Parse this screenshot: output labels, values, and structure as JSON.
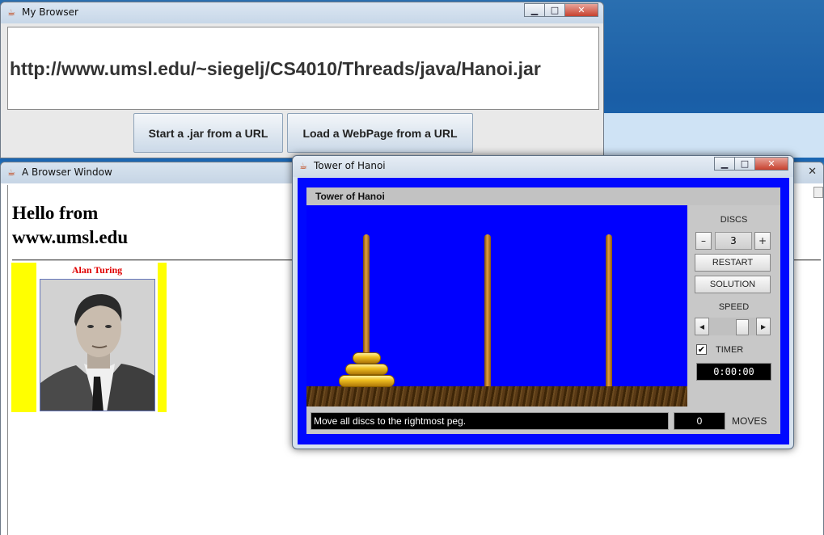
{
  "my_browser": {
    "title": "My Browser",
    "url": "http://www.umsl.edu/~siegelj/CS4010/Threads/java/Hanoi.jar",
    "start_jar_label": "Start a .jar from a URL",
    "load_page_label": "Load a WebPage from a URL"
  },
  "browser_window": {
    "title": "A Browser Window",
    "heading_line1": "Hello from",
    "heading_line2": "www.umsl.edu",
    "image_caption": "Alan Turing"
  },
  "hanoi": {
    "window_title": "Tower of Hanoi",
    "applet_title": "Tower of Hanoi",
    "discs_label": "DISCS",
    "disc_count": "3",
    "minus_label": "–",
    "plus_label": "+",
    "restart_label": "RESTART",
    "solution_label": "SOLUTION",
    "speed_label": "SPEED",
    "timer_checked": true,
    "timer_label": "TIMER",
    "timer_value": "0:00:00",
    "status_message": "Move all discs to the rightmost peg.",
    "moves_value": "0",
    "moves_label": "MOVES"
  },
  "window_controls": {
    "minimize": "▁",
    "maximize": "□",
    "close": "✕"
  },
  "colors": {
    "hanoi_frame": "#0008ff",
    "board": "#0000ff",
    "turing_bg": "#ffff00",
    "turing_name": "#e00000"
  }
}
